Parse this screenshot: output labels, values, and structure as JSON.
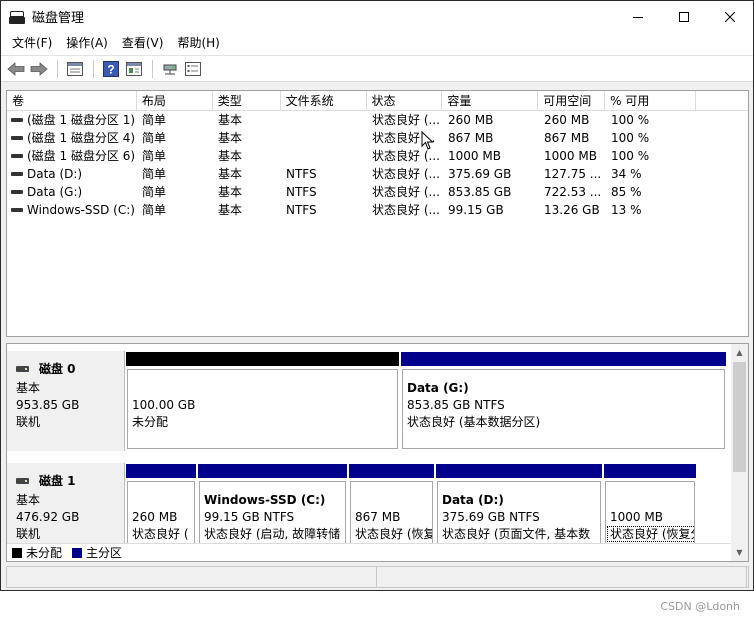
{
  "window": {
    "title": "磁盘管理"
  },
  "menu": [
    "文件(F)",
    "操作(A)",
    "查看(V)",
    "帮助(H)"
  ],
  "toolbar_icons": [
    "back-arrow-icon",
    "forward-arrow-icon",
    "properties-icon",
    "help-icon",
    "console-view-icon",
    "connect-icon",
    "settings-list-icon"
  ],
  "volume_table": {
    "columns": [
      "卷",
      "布局",
      "类型",
      "文件系统",
      "状态",
      "容量",
      "可用空间",
      "% 可用"
    ],
    "rows": [
      [
        "(磁盘 1 磁盘分区 1)",
        "简单",
        "基本",
        "",
        "状态良好 (...",
        "260 MB",
        "260 MB",
        "100 %"
      ],
      [
        "(磁盘 1 磁盘分区 4)",
        "简单",
        "基本",
        "",
        "状态良好 ...",
        "867 MB",
        "867 MB",
        "100 %"
      ],
      [
        "(磁盘 1 磁盘分区 6)",
        "简单",
        "基本",
        "",
        "状态良好 (...",
        "1000 MB",
        "1000 MB",
        "100 %"
      ],
      [
        "Data (D:)",
        "简单",
        "基本",
        "NTFS",
        "状态良好 (...",
        "375.69 GB",
        "127.75 ...",
        "34 %"
      ],
      [
        "Data (G:)",
        "简单",
        "基本",
        "NTFS",
        "状态良好 (...",
        "853.85 GB",
        "722.53 ...",
        "85 %"
      ],
      [
        "Windows-SSD (C:)",
        "简单",
        "基本",
        "NTFS",
        "状态良好 (...",
        "99.15 GB",
        "13.26 GB",
        "13 %"
      ]
    ]
  },
  "disks": [
    {
      "name": "磁盘 0",
      "type": "基本",
      "size": "953.85 GB",
      "state": "联机",
      "partitions": [
        {
          "title": "",
          "line1": "100.00 GB",
          "line2": "未分配",
          "bar": "black"
        },
        {
          "title": "Data  (G:)",
          "line1": "853.85 GB NTFS",
          "line2": "状态良好 (基本数据分区)",
          "bar": "blue"
        }
      ]
    },
    {
      "name": "磁盘 1",
      "type": "基本",
      "size": "476.92 GB",
      "state": "联机",
      "partitions": [
        {
          "title": "",
          "line1": "260 MB",
          "line2": "状态良好 (",
          "bar": "blue"
        },
        {
          "title": "Windows-SSD  (C:)",
          "line1": "99.15 GB NTFS",
          "line2": "状态良好 (启动, 故障转储",
          "bar": "blue"
        },
        {
          "title": "",
          "line1": "867 MB",
          "line2": "状态良好 (恢复",
          "bar": "blue"
        },
        {
          "title": "Data  (D:)",
          "line1": "375.69 GB NTFS",
          "line2": "状态良好 (页面文件, 基本数",
          "bar": "blue"
        },
        {
          "title": "",
          "line1": "1000 MB",
          "line2": "状态良好 (恢复分区)",
          "bar": "blue"
        }
      ]
    }
  ],
  "legend": [
    {
      "label": "未分配",
      "color": "#000000"
    },
    {
      "label": "主分区",
      "color": "#00008b"
    }
  ],
  "watermark": "CSDN @Ldonh"
}
